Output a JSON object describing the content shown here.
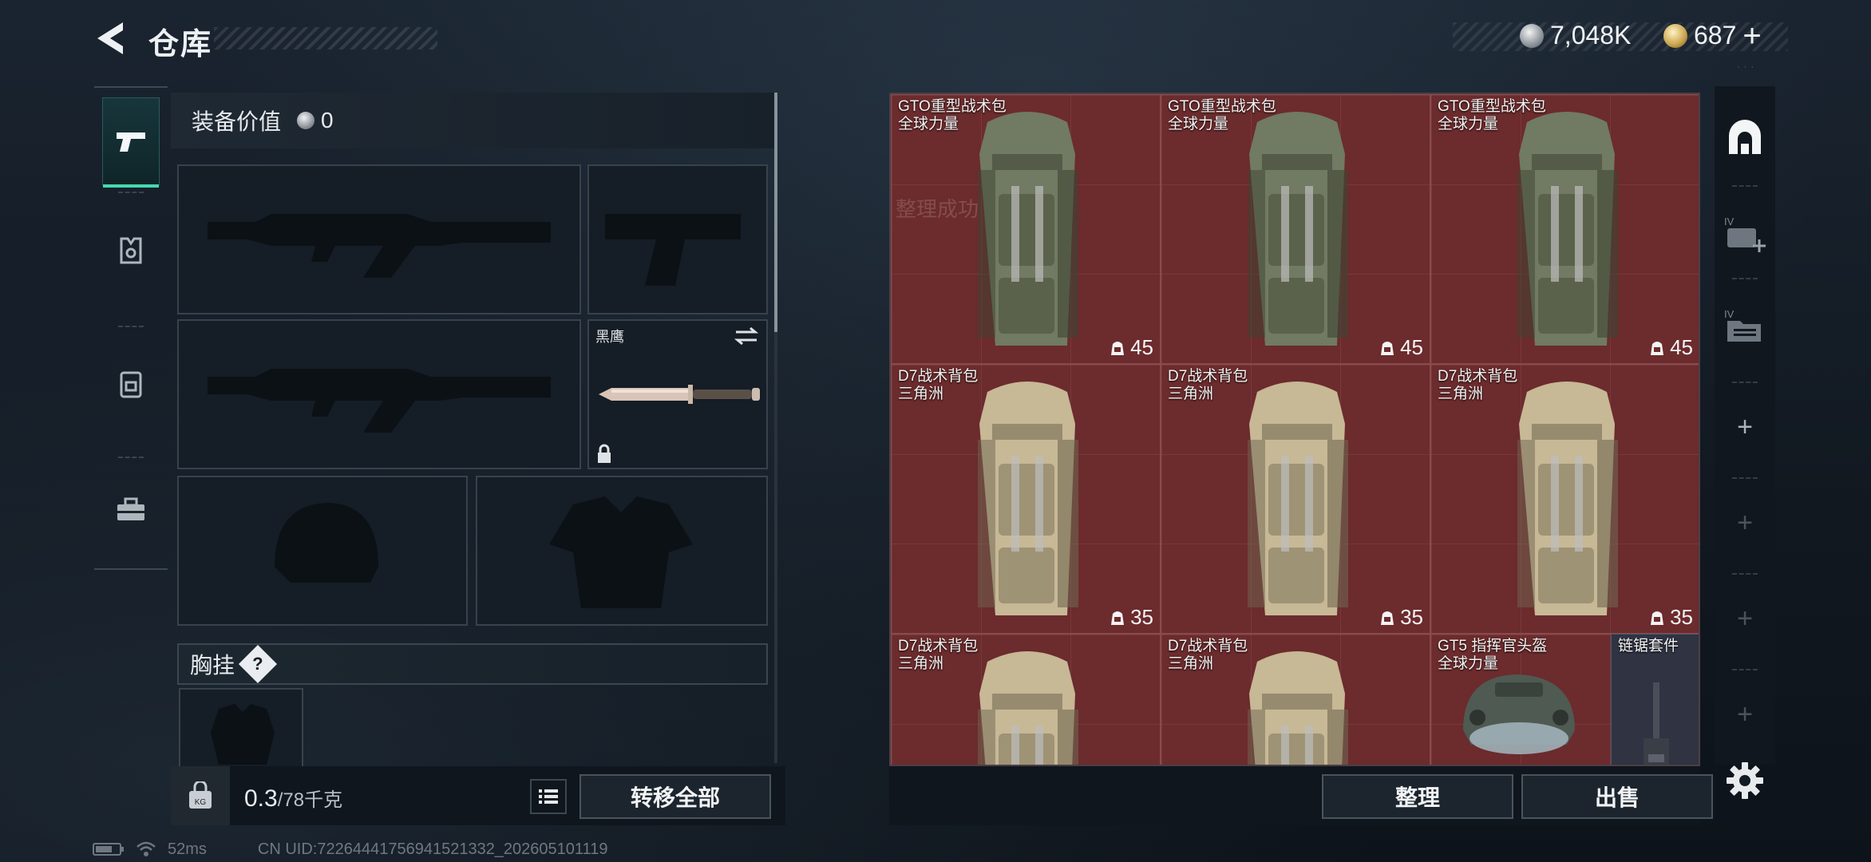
{
  "header": {
    "title": "仓库",
    "currency_silver": "7,048K",
    "currency_gold": "687"
  },
  "equipment": {
    "value_label": "装备价值",
    "value": "0",
    "knife_label": "黑鹰",
    "chest_rig_label": "胸挂",
    "help_badge": "?"
  },
  "weight": {
    "current": "0.3",
    "max": "78千克"
  },
  "buttons": {
    "transfer_all": "转移全部",
    "organize": "整理",
    "sell": "出售"
  },
  "storage": {
    "ghost_text": "整理成功",
    "items": [
      {
        "name": "GTO重型战术包",
        "sub": "全球力量",
        "capacity": "45",
        "color": "olive"
      },
      {
        "name": "GTO重型战术包",
        "sub": "全球力量",
        "capacity": "45",
        "color": "olive"
      },
      {
        "name": "GTO重型战术包",
        "sub": "全球力量",
        "capacity": "45",
        "color": "olive"
      },
      {
        "name": "D7战术背包",
        "sub": "三角洲",
        "capacity": "35",
        "color": "tan"
      },
      {
        "name": "D7战术背包",
        "sub": "三角洲",
        "capacity": "35",
        "color": "tan"
      },
      {
        "name": "D7战术背包",
        "sub": "三角洲",
        "capacity": "35",
        "color": "tan"
      },
      {
        "name": "D7战术背包",
        "sub": "三角洲",
        "capacity": "",
        "color": "tan"
      },
      {
        "name": "D7战术背包",
        "sub": "三角洲",
        "capacity": "",
        "color": "tan"
      },
      {
        "name": "GT5 指挥官头盔",
        "sub": "全球力量",
        "capacity": "",
        "color": "helmet"
      },
      {
        "name": "链锯套件",
        "sub": "",
        "capacity": "",
        "color": "tool"
      }
    ]
  },
  "status": {
    "ping": "52ms",
    "uid": "CN UID:722644417569415213​32_202605101119"
  },
  "colors": {
    "accent": "#46d9b0",
    "storage_cell": "#6c2b2d",
    "tool_cell": "#2f3342"
  }
}
